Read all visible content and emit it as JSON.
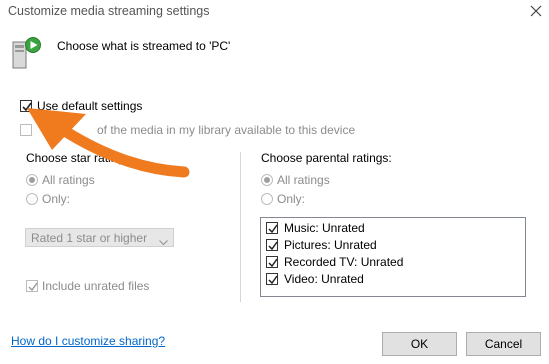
{
  "window": {
    "title": "Customize media streaming settings",
    "close_icon": "close-icon"
  },
  "header": {
    "text": "Choose what is streamed to 'PC'",
    "icon": "media-streaming-icon"
  },
  "use_default": {
    "label": "Use default settings",
    "checked": true
  },
  "make_all": {
    "label": "Make all of the media in my library available to this device",
    "label_visible_part": "of the media in my library available to this device",
    "checked": false,
    "disabled": true
  },
  "star_ratings": {
    "label": "Choose star ratings:",
    "label_visible_part": "Choose star rating",
    "all": "All ratings",
    "only": "Only:",
    "select_value": "Rated 1 star or higher",
    "include_unrated": "Include unrated files"
  },
  "parental_ratings": {
    "label": "Choose parental ratings:",
    "all": "All ratings",
    "only": "Only:",
    "items": [
      {
        "label": "Music: Unrated",
        "checked": true
      },
      {
        "label": "Pictures: Unrated",
        "checked": true
      },
      {
        "label": "Recorded TV: Unrated",
        "checked": true
      },
      {
        "label": "Video: Unrated",
        "checked": true
      }
    ]
  },
  "footer": {
    "help_link": "How do I customize sharing?",
    "ok": "OK",
    "cancel": "Cancel"
  },
  "colors": {
    "annotation_arrow": "#f07a1e",
    "link": "#0066cc"
  }
}
